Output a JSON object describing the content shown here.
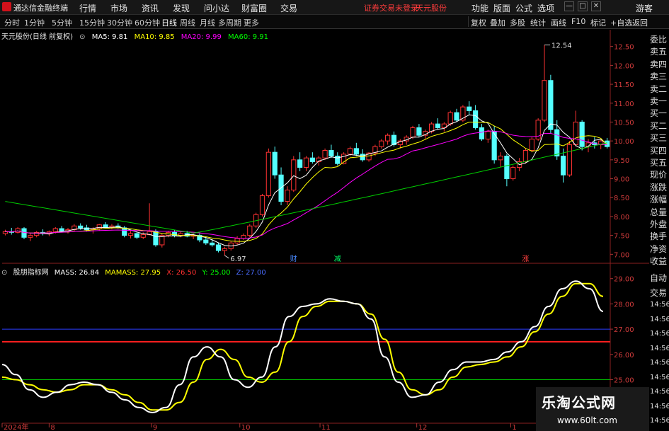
{
  "menubar": {
    "app_name": "通达信金融终端",
    "items": [
      "行情",
      "市场",
      "资讯",
      "发现",
      "问小达",
      "财富圈",
      "交易"
    ],
    "status_text": "证券交易未登录",
    "stock_name": "天元股份",
    "right_items": [
      "功能",
      "版面",
      "公式",
      "选项"
    ],
    "user": "游客",
    "window_buttons": [
      "—",
      "□",
      "✕"
    ]
  },
  "toolbar": {
    "periods": [
      "分时",
      "1分钟",
      "5分钟",
      "15分钟",
      "30分钟",
      "60分钟",
      "日线",
      "周线",
      "月线",
      "多周期",
      "更多"
    ],
    "active_period": "日线",
    "tools": [
      "复权",
      "叠加",
      "多股",
      "统计",
      "画线",
      "F10",
      "标记",
      "+自选",
      "返回"
    ]
  },
  "main_info": {
    "title": "天元股份(日线 前复权)",
    "ma5": "MA5: 9.81",
    "ma10": "MA10: 9.85",
    "ma20": "MA20: 9.99",
    "ma60": "MA60: 9.91",
    "colors": {
      "ma5": "#ffffff",
      "ma10": "#ffff00",
      "ma20": "#ff00ff",
      "ma60": "#00ff00"
    }
  },
  "indicator_info": {
    "name": "股朋指标网",
    "mass": "MASS: 26.84",
    "mamass": "MAMASS: 27.95",
    "x": "X: 26.50",
    "y": "Y: 25.00",
    "z": "Z: 27.00",
    "colors": {
      "mass": "#ffffff",
      "mamass": "#ffff00",
      "x": "#ff3030",
      "y": "#00ff00",
      "z": "#4a6cff"
    }
  },
  "price_axis": [
    "12.50",
    "12.00",
    "11.50",
    "11.00",
    "10.50",
    "10.00",
    "9.50",
    "9.00",
    "8.50",
    "8.00",
    "7.50",
    "7.00"
  ],
  "indicator_axis": [
    "29.00",
    "28.00",
    "27.00",
    "26.00",
    "25.00"
  ],
  "date_axis": [
    "2024年",
    "8",
    "9",
    "10",
    "11",
    "12",
    "1"
  ],
  "markers": {
    "high": "12.54",
    "low": "6.97",
    "events": [
      "财",
      "减",
      "涨"
    ]
  },
  "side_tabs": [
    "委比",
    "卖五",
    "卖四",
    "卖三",
    "卖二",
    "卖一",
    "买一",
    "买二",
    "买三",
    "买四",
    "买五",
    "现价",
    "涨跌",
    "涨幅",
    "总量",
    "外盘",
    "换手",
    "净资",
    "收益"
  ],
  "side_tabs_lower": [
    "自动",
    "交易",
    "14:56",
    "14:56",
    "14:56",
    "14:56",
    "14:56",
    "14:56",
    "14:56",
    "14:56",
    "14:56"
  ],
  "watermark": {
    "title": "乐淘公式网",
    "url": "www.60lt.com"
  },
  "chart_data": {
    "type": "candlestick",
    "price_ylim": [
      6.8,
      12.7
    ],
    "indicator_ylim": [
      23.5,
      29.3
    ],
    "ohlc": [
      [
        7.55,
        7.65,
        7.5,
        7.6
      ],
      [
        7.6,
        7.7,
        7.52,
        7.58
      ],
      [
        7.58,
        7.72,
        7.55,
        7.68
      ],
      [
        7.68,
        7.72,
        7.4,
        7.45
      ],
      [
        7.45,
        7.55,
        7.35,
        7.5
      ],
      [
        7.5,
        7.62,
        7.45,
        7.58
      ],
      [
        7.58,
        7.66,
        7.5,
        7.55
      ],
      [
        7.55,
        7.63,
        7.48,
        7.6
      ],
      [
        7.6,
        7.72,
        7.55,
        7.68
      ],
      [
        7.68,
        7.75,
        7.6,
        7.62
      ],
      [
        7.62,
        7.7,
        7.55,
        7.65
      ],
      [
        7.65,
        7.8,
        7.6,
        7.75
      ],
      [
        7.75,
        7.82,
        7.65,
        7.7
      ],
      [
        7.7,
        7.78,
        7.6,
        7.65
      ],
      [
        7.65,
        7.72,
        7.55,
        7.68
      ],
      [
        7.68,
        7.8,
        7.62,
        7.78
      ],
      [
        7.78,
        7.85,
        7.7,
        7.72
      ],
      [
        7.72,
        7.8,
        7.66,
        7.75
      ],
      [
        7.75,
        7.82,
        7.68,
        7.7
      ],
      [
        7.7,
        7.75,
        7.45,
        7.5
      ],
      [
        7.5,
        7.62,
        7.42,
        7.55
      ],
      [
        7.55,
        7.6,
        7.4,
        7.45
      ],
      [
        7.45,
        7.58,
        7.4,
        7.52
      ],
      [
        7.52,
        8.35,
        7.5,
        7.6
      ],
      [
        7.6,
        7.66,
        7.2,
        7.25
      ],
      [
        7.25,
        7.55,
        7.18,
        7.5
      ],
      [
        7.5,
        7.62,
        7.45,
        7.58
      ],
      [
        7.58,
        7.65,
        7.45,
        7.5
      ],
      [
        7.5,
        7.6,
        7.45,
        7.55
      ],
      [
        7.55,
        7.62,
        7.45,
        7.48
      ],
      [
        7.48,
        7.55,
        7.4,
        7.5
      ],
      [
        7.5,
        7.55,
        7.32,
        7.38
      ],
      [
        7.38,
        7.46,
        7.25,
        7.3
      ],
      [
        7.3,
        7.4,
        7.2,
        7.25
      ],
      [
        7.25,
        7.3,
        7.05,
        7.1
      ],
      [
        7.1,
        7.2,
        6.97,
        7.15
      ],
      [
        7.15,
        7.35,
        7.1,
        7.3
      ],
      [
        7.3,
        7.48,
        7.25,
        7.42
      ],
      [
        7.42,
        7.55,
        7.38,
        7.5
      ],
      [
        7.5,
        7.8,
        7.45,
        7.75
      ],
      [
        7.75,
        8.1,
        7.7,
        8.05
      ],
      [
        8.05,
        8.6,
        8.0,
        8.55
      ],
      [
        8.55,
        9.8,
        8.5,
        9.7
      ],
      [
        9.7,
        9.85,
        9.0,
        9.1
      ],
      [
        9.1,
        9.3,
        8.3,
        8.4
      ],
      [
        8.4,
        8.8,
        8.3,
        8.7
      ],
      [
        8.7,
        9.6,
        8.65,
        9.5
      ],
      [
        9.5,
        9.7,
        9.2,
        9.3
      ],
      [
        9.3,
        9.6,
        9.2,
        9.55
      ],
      [
        9.55,
        9.7,
        9.4,
        9.45
      ],
      [
        9.45,
        9.6,
        9.35,
        9.55
      ],
      [
        9.55,
        9.8,
        9.5,
        9.75
      ],
      [
        9.75,
        9.9,
        9.55,
        9.6
      ],
      [
        9.6,
        9.7,
        9.35,
        9.4
      ],
      [
        9.4,
        9.7,
        9.38,
        9.65
      ],
      [
        9.65,
        9.85,
        9.6,
        9.8
      ],
      [
        9.8,
        9.95,
        9.6,
        9.65
      ],
      [
        9.65,
        9.78,
        9.45,
        9.5
      ],
      [
        9.5,
        9.7,
        9.45,
        9.68
      ],
      [
        9.68,
        9.9,
        9.6,
        9.85
      ],
      [
        9.85,
        10.05,
        9.8,
        10.0
      ],
      [
        10.0,
        10.2,
        9.9,
        10.15
      ],
      [
        10.15,
        10.25,
        9.85,
        9.9
      ],
      [
        9.9,
        10.05,
        9.8,
        10.0
      ],
      [
        10.0,
        10.15,
        9.9,
        10.1
      ],
      [
        10.1,
        10.4,
        10.05,
        10.35
      ],
      [
        10.35,
        10.45,
        10.1,
        10.15
      ],
      [
        10.15,
        10.3,
        10.05,
        10.25
      ],
      [
        10.25,
        10.5,
        10.2,
        10.45
      ],
      [
        10.45,
        10.6,
        10.3,
        10.35
      ],
      [
        10.35,
        10.5,
        10.25,
        10.45
      ],
      [
        10.45,
        10.8,
        10.4,
        10.75
      ],
      [
        10.75,
        10.85,
        10.5,
        10.55
      ],
      [
        10.55,
        10.95,
        10.5,
        10.9
      ],
      [
        10.9,
        11.05,
        10.7,
        10.8
      ],
      [
        10.8,
        10.95,
        10.3,
        10.35
      ],
      [
        10.35,
        10.45,
        10.0,
        10.05
      ],
      [
        10.05,
        10.3,
        9.95,
        10.25
      ],
      [
        10.25,
        10.4,
        9.4,
        9.5
      ],
      [
        9.5,
        9.7,
        9.3,
        9.6
      ],
      [
        9.6,
        9.65,
        8.8,
        9.0
      ],
      [
        9.0,
        9.35,
        8.95,
        9.3
      ],
      [
        9.3,
        9.55,
        9.2,
        9.45
      ],
      [
        9.45,
        9.8,
        9.4,
        9.75
      ],
      [
        9.75,
        10.1,
        9.7,
        10.05
      ],
      [
        10.05,
        10.6,
        10.0,
        10.55
      ],
      [
        10.55,
        12.54,
        10.5,
        11.6
      ],
      [
        11.6,
        11.75,
        10.2,
        10.3
      ],
      [
        10.3,
        10.55,
        9.5,
        9.6
      ],
      [
        9.6,
        9.8,
        8.9,
        9.1
      ],
      [
        9.1,
        10.0,
        9.05,
        9.9
      ],
      [
        9.9,
        10.8,
        9.85,
        10.5
      ],
      [
        10.5,
        10.55,
        9.75,
        9.85
      ],
      [
        9.85,
        10.05,
        9.7,
        9.95
      ],
      [
        9.95,
        10.1,
        9.8,
        9.9
      ],
      [
        9.9,
        10.05,
        9.78,
        10.0
      ],
      [
        10.0,
        10.08,
        9.8,
        9.85
      ]
    ],
    "mass": [
      25.6,
      25.2,
      24.6,
      24.3,
      24.5,
      24.8,
      24.9,
      24.8,
      24.5,
      24.2,
      23.9,
      23.7,
      23.9,
      24.8,
      25.9,
      26.3,
      25.9,
      25.0,
      24.7,
      25.1,
      26.3,
      27.5,
      27.9,
      28.0,
      28.2,
      28.1,
      28.0,
      27.4,
      25.9,
      24.9,
      24.3,
      24.4,
      24.9,
      25.4,
      25.7,
      25.7,
      25.8,
      26.1,
      26.5,
      27.1,
      27.9,
      28.6,
      28.9,
      28.6,
      27.7
    ],
    "mamass": [
      25.1,
      25.0,
      24.8,
      24.6,
      24.5,
      24.6,
      24.8,
      24.8,
      24.6,
      24.4,
      24.1,
      23.8,
      23.8,
      24.1,
      24.9,
      25.8,
      26.2,
      25.8,
      25.1,
      24.9,
      25.3,
      26.5,
      27.5,
      27.9,
      28.1,
      28.1,
      28.0,
      27.6,
      26.6,
      25.3,
      24.6,
      24.4,
      24.6,
      25.1,
      25.5,
      25.6,
      25.7,
      25.9,
      26.3,
      26.9,
      27.6,
      28.3,
      28.8,
      28.8,
      28.3
    ],
    "x_level": 26.5,
    "y_level": 25.0,
    "z_level": 27.0
  }
}
